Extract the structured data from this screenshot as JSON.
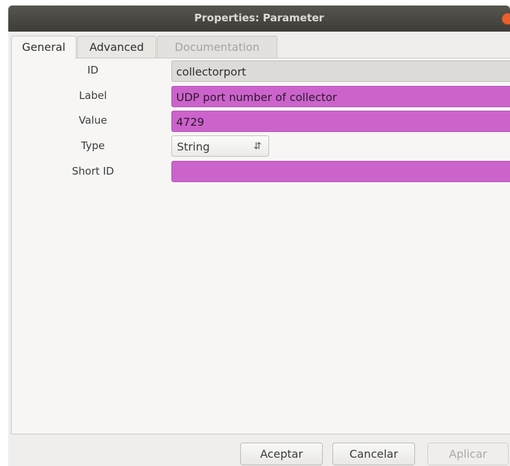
{
  "window": {
    "title": "Properties: Parameter"
  },
  "tabs": [
    {
      "label": "General",
      "state": "active"
    },
    {
      "label": "Advanced",
      "state": "normal"
    },
    {
      "label": "Documentation",
      "state": "disabled"
    }
  ],
  "form": {
    "id": {
      "label": "ID",
      "value": "collectorport"
    },
    "label": {
      "label": "Label",
      "value": "UDP port number of collector"
    },
    "value": {
      "label": "Value",
      "value": "4729"
    },
    "type": {
      "label": "Type",
      "value": "String"
    },
    "short_id": {
      "label": "Short ID",
      "value": ""
    }
  },
  "buttons": {
    "accept": "Aceptar",
    "cancel": "Cancelar",
    "apply": "Aplicar"
  },
  "colors": {
    "titlebar": "#3d3c38",
    "pink_field": "#cc63cc",
    "close_button": "#e9622e"
  }
}
